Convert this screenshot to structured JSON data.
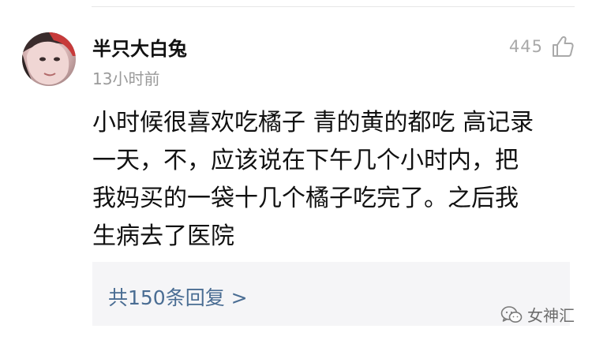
{
  "comment": {
    "username": "半只大白兔",
    "timestamp": "13小时前",
    "like_count": "445",
    "body_lines": [
      "小时候很喜欢吃橘子 青的黄的都吃 高记录",
      "一天，不，应该说在下午几个小时内，把",
      "我妈买的一袋十几个橘子吃完了。之后我",
      "生病去了医院"
    ],
    "replies_label": "共150条回复 >"
  },
  "watermark": {
    "text": "女神汇",
    "icon": "wechat-icon"
  },
  "icons": {
    "like": "thumbs-up-icon",
    "avatar": "avatar-photo"
  },
  "colors": {
    "link": "#4a6d93",
    "muted": "#9a9a9a",
    "reply_bg": "#f5f5f7"
  }
}
